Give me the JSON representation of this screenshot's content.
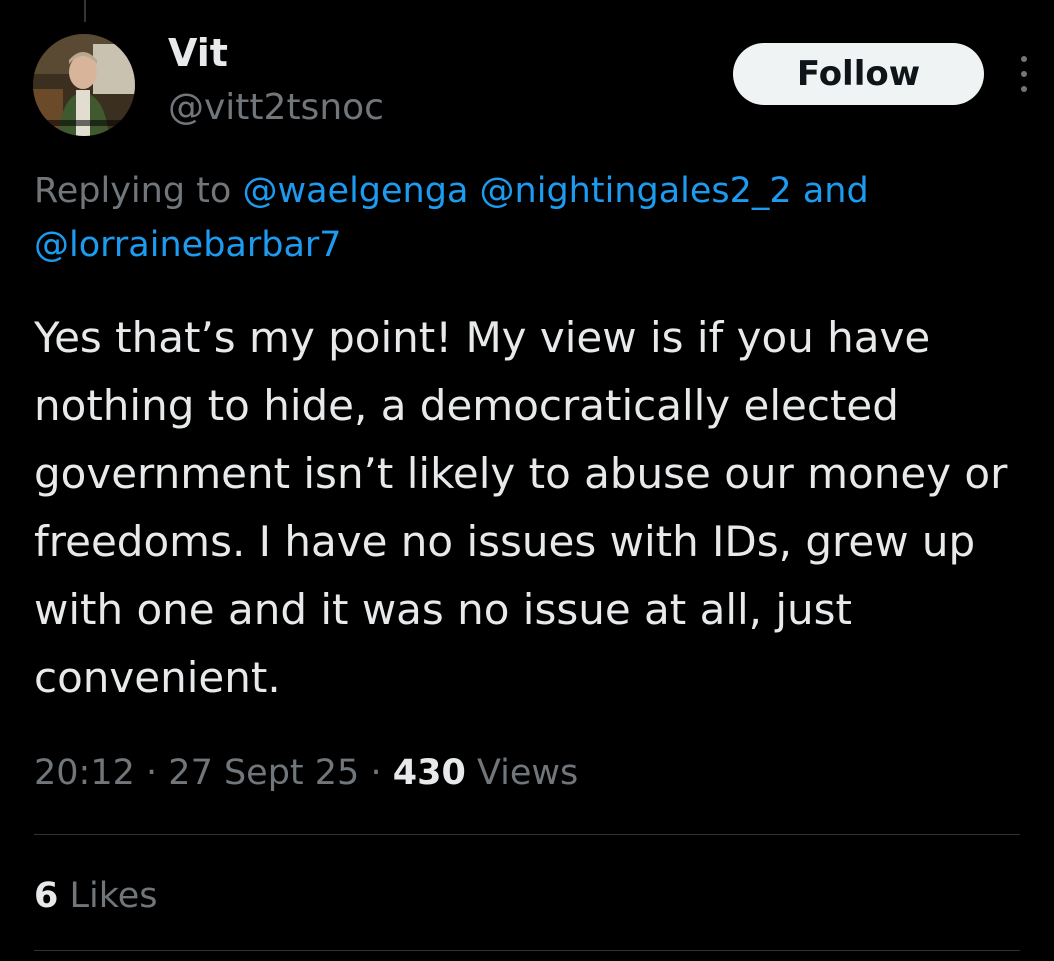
{
  "tweet": {
    "author": {
      "display_name": "Vit",
      "handle": "@vitt2tsnoc",
      "avatar_icon": "profile-photo"
    },
    "follow_label": "Follow",
    "more_icon": "more-options-icon",
    "replying": {
      "prefix": "Replying to",
      "mentions": [
        "@waelgenga",
        "@nightingales2_2"
      ],
      "conjunction": "and",
      "last_mention": "@lorrainebarbar7"
    },
    "text": "Yes that’s my point! My view is if you have nothing to hide, a democratically elected government isn’t likely to abuse our money or freedoms. I have no issues with IDs, grew up with one and it was no issue at all, just convenient.",
    "time": "20:12",
    "date": "27 Sept 25",
    "separator": "·",
    "views_count": "430",
    "views_label": "Views",
    "likes_count": "6",
    "likes_label": "Likes"
  },
  "colors": {
    "background": "#000000",
    "primary_text": "#e7e9ea",
    "secondary_text": "#71767b",
    "link": "#1d9bf0",
    "follow_button_bg": "#eff3f4",
    "divider": "#2f3336"
  }
}
